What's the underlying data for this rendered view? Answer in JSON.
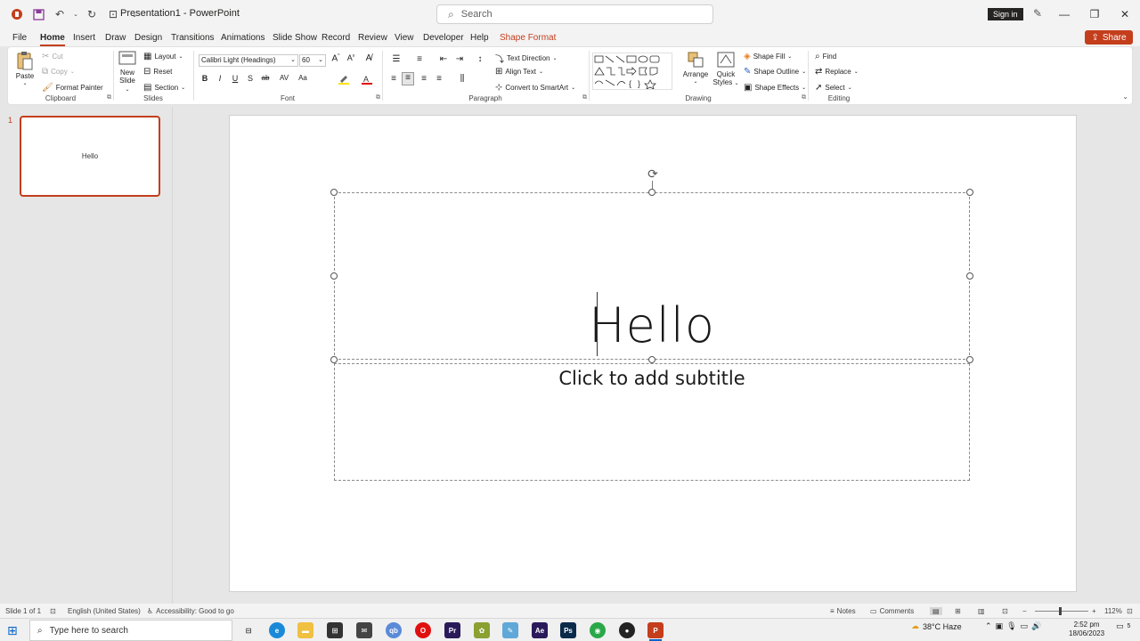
{
  "titlebar": {
    "app_title": "Presentation1 - PowerPoint",
    "search_placeholder": "Search",
    "signin": "Sign in"
  },
  "tabs": [
    "File",
    "Home",
    "Insert",
    "Draw",
    "Design",
    "Transitions",
    "Animations",
    "Slide Show",
    "Record",
    "Review",
    "View",
    "Developer",
    "Help",
    "Shape Format"
  ],
  "active_tab": "Home",
  "share_label": "Share",
  "ribbon": {
    "clipboard": {
      "paste": "Paste",
      "cut": "Cut",
      "copy": "Copy",
      "format_painter": "Format Painter",
      "label": "Clipboard"
    },
    "slides": {
      "new_slide_1": "New",
      "new_slide_2": "Slide",
      "layout": "Layout",
      "reset": "Reset",
      "section": "Section",
      "label": "Slides"
    },
    "font": {
      "font_name": "Calibri Light (Headings)",
      "font_size": "60",
      "bold": "B",
      "italic": "I",
      "underline": "U",
      "shadow": "S",
      "strike": "ab",
      "spacing": "AV",
      "case": "Aa",
      "label": "Font"
    },
    "paragraph": {
      "text_direction": "Text Direction",
      "align_text": "Align Text",
      "convert_smartart": "Convert to SmartArt",
      "label": "Paragraph"
    },
    "drawing": {
      "arrange": "Arrange",
      "quick_styles_1": "Quick",
      "quick_styles_2": "Styles",
      "shape_fill": "Shape Fill",
      "shape_outline": "Shape Outline",
      "shape_effects": "Shape Effects",
      "label": "Drawing"
    },
    "editing": {
      "find": "Find",
      "replace": "Replace",
      "select": "Select",
      "label": "Editing"
    }
  },
  "thumbnail": {
    "number": "1",
    "text": "Hello"
  },
  "slide": {
    "title": "Hello",
    "subtitle_placeholder": "Click to add subtitle"
  },
  "statusbar": {
    "slide_info": "Slide 1 of 1",
    "language": "English (United States)",
    "accessibility": "Accessibility: Good to go",
    "notes": "Notes",
    "comments": "Comments",
    "zoom": "112%"
  },
  "taskbar": {
    "search_placeholder": "Type here to search",
    "weather": "38°C Haze",
    "time": "2:52 pm",
    "date": "18/06/2023",
    "notifications": "5"
  },
  "colors": {
    "accent": "#c43e1c",
    "windows_blue": "#0a64c8"
  }
}
